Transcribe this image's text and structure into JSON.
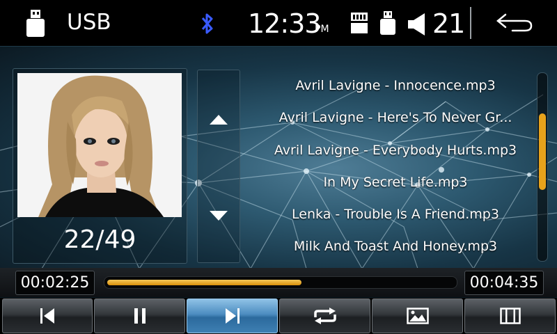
{
  "status_bar": {
    "source_label": "USB",
    "clock_time": "12:33",
    "clock_ampm": "PM",
    "volume_level": "21",
    "icons": [
      "usb-icon",
      "bluetooth-icon",
      "sd-card-icon",
      "usb-small-icon",
      "speaker-icon",
      "back-icon"
    ]
  },
  "album": {
    "track_counter": "22/49"
  },
  "playlist": {
    "items": [
      "Avril Lavigne - Innocence.mp3",
      "Avril Lavigne - Here's To Never Gr...",
      "Avril Lavigne - Everybody Hurts.mp3",
      "In My Secret Life.mp3",
      "Lenka - Trouble Is A Friend.mp3",
      "Milk And Toast And Honey.mp3"
    ],
    "scroll_position": 0.36
  },
  "progress": {
    "elapsed": "00:02:25",
    "duration": "00:04:35",
    "fraction": 0.56
  },
  "controls": [
    {
      "name": "previous",
      "icon": "skip-previous-icon",
      "active": false
    },
    {
      "name": "pause",
      "icon": "pause-icon",
      "active": false
    },
    {
      "name": "next",
      "icon": "skip-next-icon",
      "active": true
    },
    {
      "name": "repeat",
      "icon": "repeat-icon",
      "active": false
    },
    {
      "name": "picture",
      "icon": "image-icon",
      "active": false
    },
    {
      "name": "video",
      "icon": "film-icon",
      "active": false
    }
  ],
  "colors": {
    "accent": "#e7a21b",
    "bluetooth": "#3a5bff",
    "active_button": "#4c8cc0"
  }
}
